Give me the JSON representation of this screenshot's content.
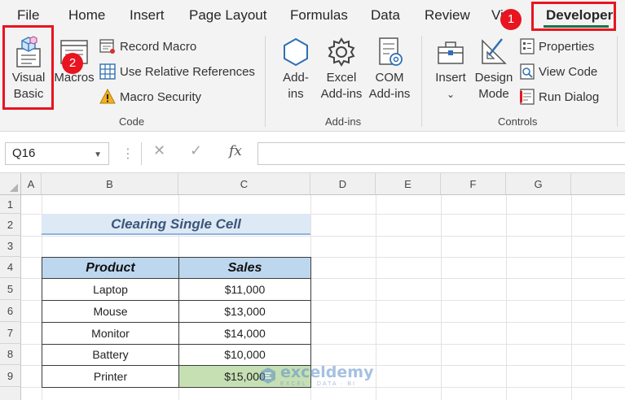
{
  "menu": {
    "tabs": [
      "File",
      "Home",
      "Insert",
      "Page Layout",
      "Formulas",
      "Data",
      "Review",
      "Vi",
      "Developer"
    ],
    "active_tab": "Developer"
  },
  "badges": [
    "1",
    "2"
  ],
  "ribbon": {
    "code": {
      "label": "Code",
      "visual_basic": [
        "Visual",
        "Basic"
      ],
      "macros": "Macros",
      "record_macro": "Record Macro",
      "use_relative_references": "Use Relative References",
      "macro_security": "Macro Security"
    },
    "addins": {
      "label": "Add-ins",
      "addins_btn": [
        "Add-",
        "ins"
      ],
      "excel_addins": [
        "Excel",
        "Add-ins"
      ],
      "com_addins": [
        "COM",
        "Add-ins"
      ]
    },
    "controls": {
      "label": "Controls",
      "insert": "Insert",
      "insert_caret": "⌄",
      "design_mode": [
        "Design",
        "Mode"
      ],
      "properties": "Properties",
      "view_code": "View Code",
      "run_dialog": "Run Dialog"
    }
  },
  "formula_bar": {
    "name_box": "Q16",
    "fx": "fx",
    "cancel": "✕",
    "enter": "✓",
    "value": ""
  },
  "grid": {
    "columns": [
      "A",
      "B",
      "C",
      "D",
      "E",
      "F",
      "G"
    ],
    "rows": [
      "1",
      "2",
      "3",
      "4",
      "5",
      "6",
      "7",
      "8",
      "9"
    ],
    "title": "Clearing Single Cell",
    "table": {
      "headers": [
        "Product",
        "Sales"
      ],
      "rows": [
        [
          "Laptop",
          "$11,000"
        ],
        [
          "Mouse",
          "$13,000"
        ],
        [
          "Monitor",
          "$14,000"
        ],
        [
          "Battery",
          "$10,000"
        ],
        [
          "Printer",
          "$15,000"
        ]
      ]
    }
  },
  "watermark": {
    "name": "exceldemy",
    "tagline": "EXCEL · DATA · BI"
  },
  "colors": {
    "accent_green": "#1e7145",
    "highlight_red": "#e8141f",
    "header_blue": "#bdd7ee",
    "selected_green": "#c6e0b4"
  }
}
